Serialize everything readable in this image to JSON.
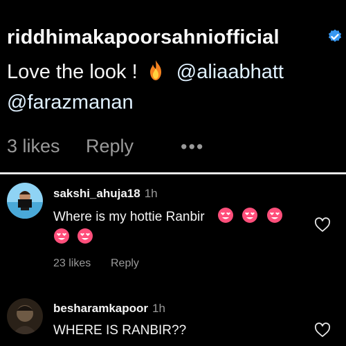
{
  "post_comment": {
    "username": "riddhimakapoorsahniofficial",
    "text_prefix": "Love the look !",
    "emoji": "fire-emoji",
    "mention1": "@aliaabhatt",
    "mention2": "@farazmanan",
    "likes": "3 likes",
    "reply": "Reply",
    "more": "•••"
  },
  "comments": [
    {
      "username": "sakshi_ahuja18",
      "time": "1h",
      "text": "Where is my hottie Ranbir",
      "emojis": [
        "heart-eyes-emoji",
        "heart-eyes-emoji",
        "heart-eyes-emoji",
        "heart-eyes-emoji",
        "heart-eyes-emoji"
      ],
      "likes": "23 likes",
      "reply": "Reply"
    },
    {
      "username": "besharamkapoor",
      "time": "1h",
      "text": "WHERE IS RANBIR??"
    }
  ],
  "colors": {
    "background": "#000000",
    "text": "#f5f5f5",
    "muted": "#9a9a9a",
    "verified": "#3897f0",
    "heart_eyes_face": "#ff4f7b"
  }
}
